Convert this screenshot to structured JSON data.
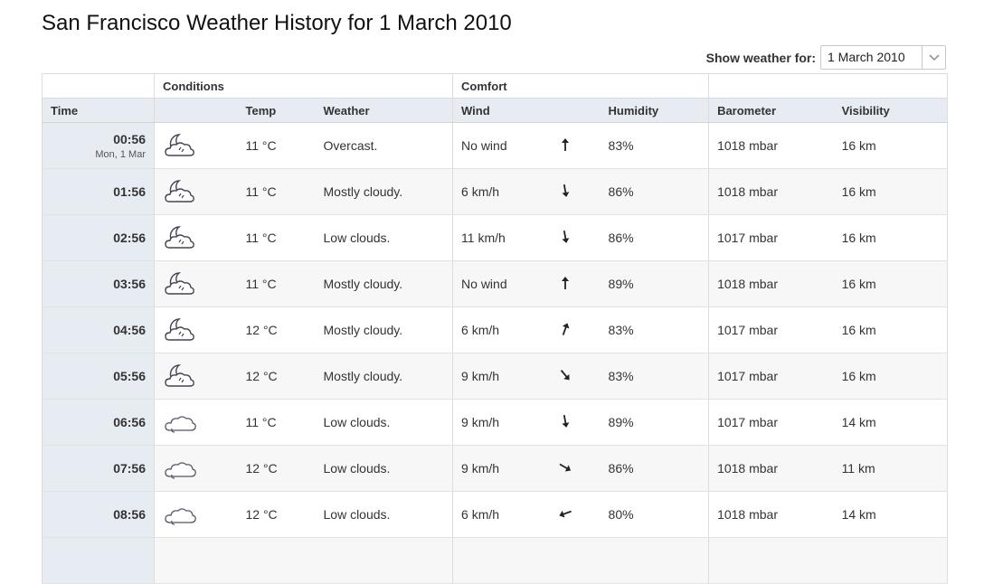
{
  "page": {
    "title": "San Francisco Weather History for 1 March 2010",
    "show_label": "Show weather for:",
    "date_value": "1 March 2010"
  },
  "table": {
    "groups": {
      "conditions": "Conditions",
      "comfort": "Comfort"
    },
    "headers": {
      "time": "Time",
      "temp": "Temp",
      "weather": "Weather",
      "wind": "Wind",
      "humidity": "Humidity",
      "barometer": "Barometer",
      "visibility": "Visibility"
    },
    "rows": [
      {
        "time": "00:56",
        "date": "Mon, 1 Mar",
        "icon": "partly-cloudy-night-icon",
        "temp": "11 °C",
        "weather": "Overcast.",
        "wind": "No wind",
        "wind_dir_deg": 180,
        "humidity": "83%",
        "barometer": "1018 mbar",
        "visibility": "16 km"
      },
      {
        "time": "01:56",
        "date": "",
        "icon": "partly-cloudy-night-icon",
        "temp": "11 °C",
        "weather": "Mostly cloudy.",
        "wind": "6 km/h",
        "wind_dir_deg": 350,
        "humidity": "86%",
        "barometer": "1018 mbar",
        "visibility": "16 km"
      },
      {
        "time": "02:56",
        "date": "",
        "icon": "partly-cloudy-night-icon",
        "temp": "11 °C",
        "weather": "Low clouds.",
        "wind": "11 km/h",
        "wind_dir_deg": 350,
        "humidity": "86%",
        "barometer": "1017 mbar",
        "visibility": "16 km"
      },
      {
        "time": "03:56",
        "date": "",
        "icon": "partly-cloudy-night-icon",
        "temp": "11 °C",
        "weather": "Mostly cloudy.",
        "wind": "No wind",
        "wind_dir_deg": 180,
        "humidity": "89%",
        "barometer": "1018 mbar",
        "visibility": "16 km"
      },
      {
        "time": "04:56",
        "date": "",
        "icon": "partly-cloudy-night-icon",
        "temp": "12 °C",
        "weather": "Mostly cloudy.",
        "wind": "6 km/h",
        "wind_dir_deg": 200,
        "humidity": "83%",
        "barometer": "1017 mbar",
        "visibility": "16 km"
      },
      {
        "time": "05:56",
        "date": "",
        "icon": "partly-cloudy-night-icon",
        "temp": "12 °C",
        "weather": "Mostly cloudy.",
        "wind": "9 km/h",
        "wind_dir_deg": 320,
        "humidity": "83%",
        "barometer": "1017 mbar",
        "visibility": "16 km"
      },
      {
        "time": "06:56",
        "date": "",
        "icon": "cloudy-icon",
        "temp": "11 °C",
        "weather": "Low clouds.",
        "wind": "9 km/h",
        "wind_dir_deg": 350,
        "humidity": "89%",
        "barometer": "1017 mbar",
        "visibility": "14 km"
      },
      {
        "time": "07:56",
        "date": "",
        "icon": "cloudy-icon",
        "temp": "12 °C",
        "weather": "Low clouds.",
        "wind": "9 km/h",
        "wind_dir_deg": 300,
        "humidity": "86%",
        "barometer": "1018 mbar",
        "visibility": "11 km"
      },
      {
        "time": "08:56",
        "date": "",
        "icon": "cloudy-icon",
        "temp": "12 °C",
        "weather": "Low clouds.",
        "wind": "6 km/h",
        "wind_dir_deg": 70,
        "humidity": "80%",
        "barometer": "1018 mbar",
        "visibility": "14 km"
      },
      {
        "time": "",
        "date": "",
        "icon": "",
        "temp": "",
        "weather": "",
        "wind": "",
        "wind_dir_deg": null,
        "humidity": "",
        "barometer": "",
        "visibility": ""
      }
    ]
  }
}
